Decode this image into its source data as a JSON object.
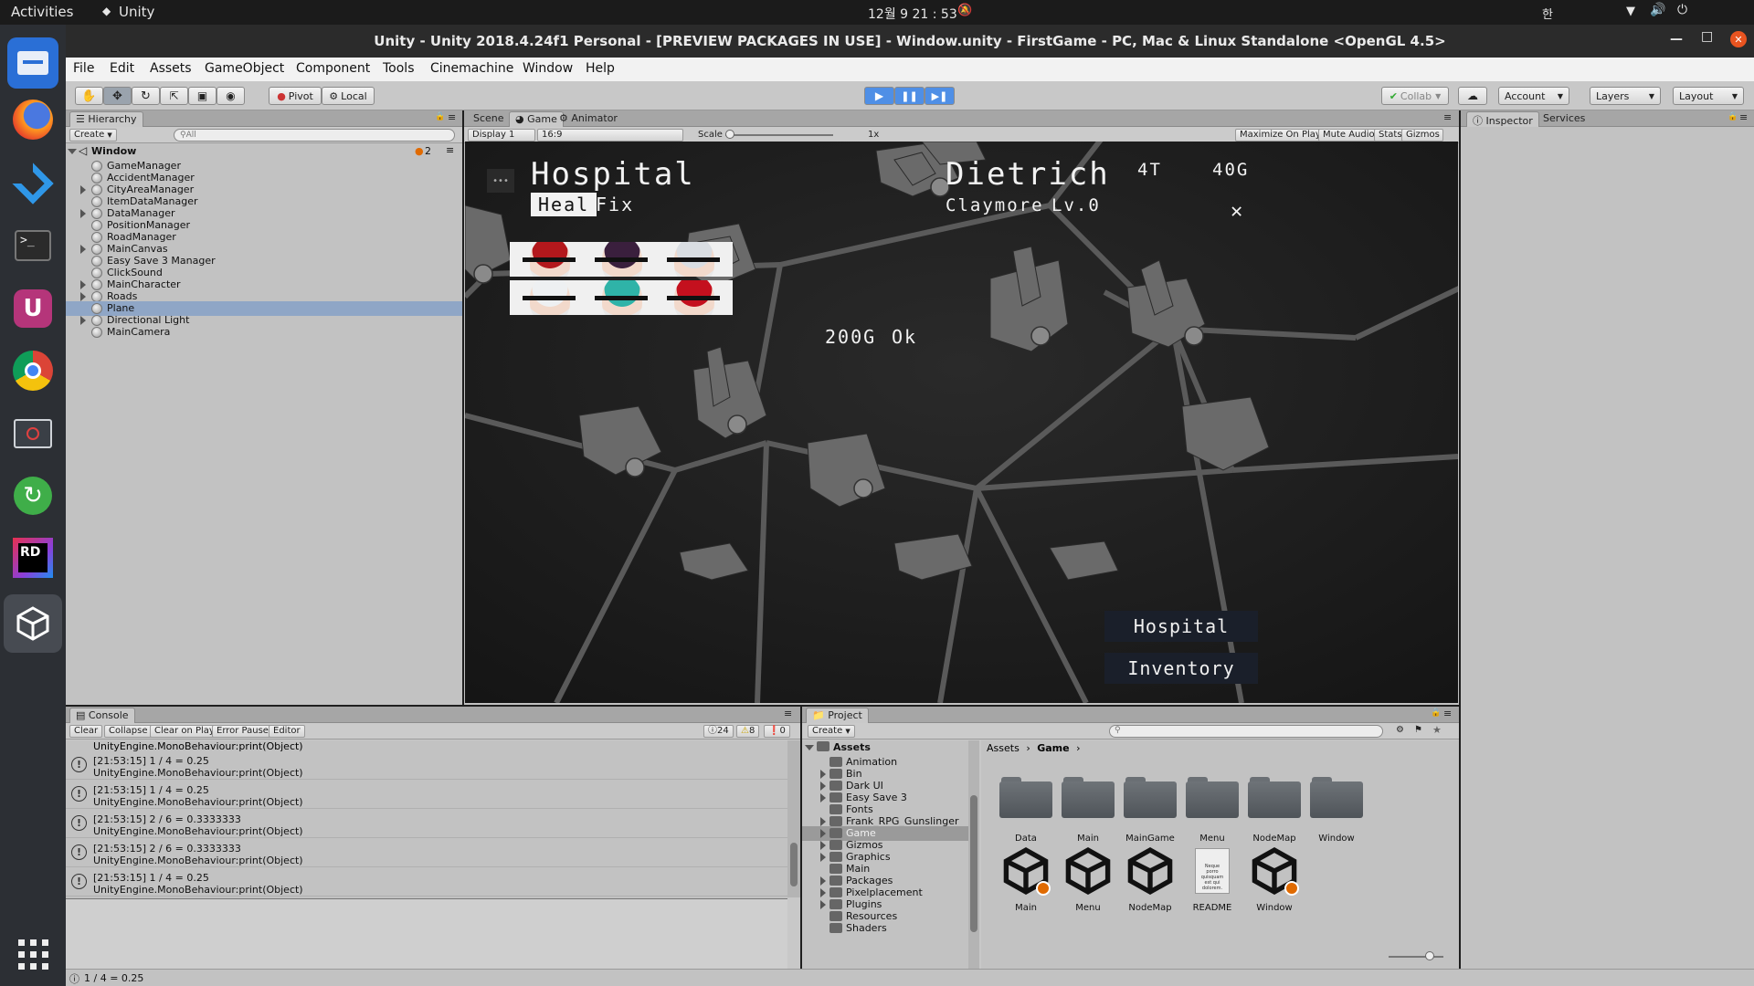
{
  "topbar": {
    "activities": "Activities",
    "app": "Unity",
    "clock": "12월 9  21 : 53",
    "ime": "한"
  },
  "dock": {
    "items": [
      "files",
      "firefox",
      "vscode",
      "terminal",
      "ubuntu-software",
      "chrome",
      "screenshot",
      "update",
      "rider",
      "unity"
    ]
  },
  "title": "Unity - Unity 2018.4.24f1 Personal - [PREVIEW PACKAGES IN USE] - Window.unity - FirstGame - PC, Mac & Linux Standalone <OpenGL 4.5>",
  "menu": [
    "File",
    "Edit",
    "Assets",
    "GameObject",
    "Component",
    "Tools",
    "Cinemachine",
    "Window",
    "Help"
  ],
  "toolbar": {
    "pivot": "Pivot",
    "local": "Local",
    "collab": "Collab",
    "account": "Account",
    "layers": "Layers",
    "layout": "Layout"
  },
  "hierarchy": {
    "tab": "Hierarchy",
    "create": "Create",
    "search_placeholder": "All",
    "scene": "Window",
    "scene_count": "2",
    "items": [
      {
        "name": "GameManager",
        "expandable": false
      },
      {
        "name": "AccidentManager",
        "expandable": false
      },
      {
        "name": "CityAreaManager",
        "expandable": true
      },
      {
        "name": "ItemDataManager",
        "expandable": false
      },
      {
        "name": "DataManager",
        "expandable": true
      },
      {
        "name": "PositionManager",
        "expandable": false
      },
      {
        "name": "RoadManager",
        "expandable": false
      },
      {
        "name": "MainCanvas",
        "expandable": true
      },
      {
        "name": "Easy Save 3 Manager",
        "expandable": false
      },
      {
        "name": "ClickSound",
        "expandable": false
      },
      {
        "name": "MainCharacter",
        "expandable": true
      },
      {
        "name": "Roads",
        "expandable": true
      },
      {
        "name": "Plane",
        "expandable": false,
        "selected": true
      },
      {
        "name": "Directional Light",
        "expandable": true
      },
      {
        "name": "MainCamera",
        "expandable": false
      }
    ]
  },
  "view_tabs": {
    "scene": "Scene",
    "game": "Game",
    "animator": "Animator"
  },
  "game_bar": {
    "display": "Display 1",
    "aspect": "16:9",
    "scale_label": "Scale",
    "scale_value": "1x",
    "maximize": "Maximize On Play",
    "mute": "Mute Audio",
    "stats": "Stats",
    "gizmos": "Gizmos"
  },
  "game": {
    "menu_dots": "•••",
    "location": "Hospital",
    "heal": "Heal",
    "fix": "Fix",
    "character": "Dietrich",
    "weapon": "Claymore",
    "level": "Lv.0",
    "turns": "4T",
    "gold": "40G",
    "cost": "200G",
    "ok": "Ok",
    "close_icon": "✕",
    "btn_hospital": "Hospital",
    "btn_inventory": "Inventory",
    "portraits": [
      {
        "hair": "#b3181c"
      },
      {
        "hair": "#3a1f3d"
      },
      {
        "hair": "#d9dde2"
      },
      {
        "hair": "#eef0f2"
      },
      {
        "hair": "#2fb3a8"
      },
      {
        "hair": "#c4101e"
      }
    ]
  },
  "inspector": {
    "tab": "Inspector",
    "services": "Services"
  },
  "console": {
    "tab": "Console",
    "buttons": [
      "Clear",
      "Collapse",
      "Clear on Play",
      "Error Pause",
      "Editor"
    ],
    "counts": {
      "info": "24",
      "warn": "8",
      "error": "0"
    },
    "top_partial": "UnityEngine.MonoBehaviour:print(Object)",
    "rows": [
      {
        "line1": "[21:53:15] 1 / 4 = 0.25",
        "line2": "UnityEngine.MonoBehaviour:print(Object)"
      },
      {
        "line1": "[21:53:15] 1 / 4 = 0.25",
        "line2": "UnityEngine.MonoBehaviour:print(Object)"
      },
      {
        "line1": "[21:53:15] 2 / 6 = 0.3333333",
        "line2": "UnityEngine.MonoBehaviour:print(Object)"
      },
      {
        "line1": "[21:53:15] 2 / 6 = 0.3333333",
        "line2": "UnityEngine.MonoBehaviour:print(Object)"
      },
      {
        "line1": "[21:53:15] 1 / 4 = 0.25",
        "line2": "UnityEngine.MonoBehaviour:print(Object)"
      }
    ]
  },
  "project": {
    "tab": "Project",
    "create": "Create",
    "root": "Assets",
    "tree": [
      {
        "name": "Animation",
        "expandable": false
      },
      {
        "name": "Bin",
        "expandable": true
      },
      {
        "name": "Dark UI",
        "expandable": true
      },
      {
        "name": "Easy Save 3",
        "expandable": true
      },
      {
        "name": "Fonts",
        "expandable": false
      },
      {
        "name": "Frank_RPG_Gunslinger",
        "expandable": true
      },
      {
        "name": "Game",
        "expandable": true,
        "selected": true
      },
      {
        "name": "Gizmos",
        "expandable": true
      },
      {
        "name": "Graphics",
        "expandable": true
      },
      {
        "name": "Main",
        "expandable": false
      },
      {
        "name": "Packages",
        "expandable": true
      },
      {
        "name": "Pixelplacement",
        "expandable": true
      },
      {
        "name": "Plugins",
        "expandable": true
      },
      {
        "name": "Resources",
        "expandable": false
      },
      {
        "name": "Shaders",
        "expandable": false
      }
    ],
    "breadcrumb": [
      "Assets",
      "Game"
    ],
    "folders": [
      "Data",
      "Main",
      "MainGame",
      "Menu",
      "NodeMap",
      "Window"
    ],
    "assets": [
      {
        "name": "Main",
        "type": "unity-scene",
        "badge": true
      },
      {
        "name": "Menu",
        "type": "unity-scene",
        "badge": false
      },
      {
        "name": "NodeMap",
        "type": "unity-scene",
        "badge": false
      },
      {
        "name": "README",
        "type": "readme",
        "badge": false
      },
      {
        "name": "Window",
        "type": "unity-scene",
        "badge": true
      }
    ],
    "readme_text": "Neque porro quisquam est qui dolorem."
  },
  "statusbar": {
    "message": "1 / 4 = 0.25"
  },
  "colors": {
    "accent_play": "#3b7bd8",
    "dock_bg": "#2c2f34",
    "game_bg": "#1c1c1c",
    "selected_row": "#8fa6c6"
  }
}
